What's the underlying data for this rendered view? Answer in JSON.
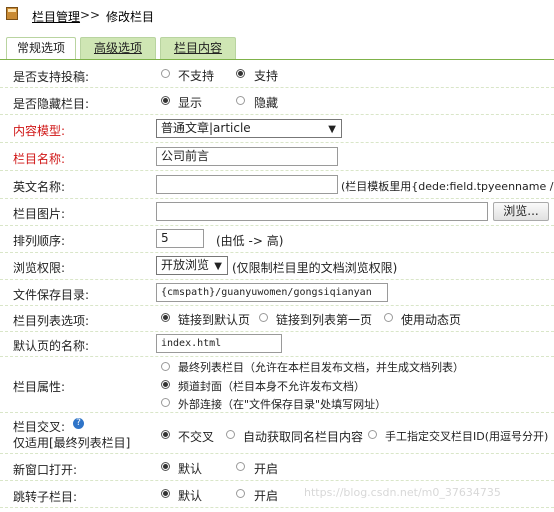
{
  "breadcrumb": {
    "section": "栏目管理",
    "separator": ">>",
    "current": "修改栏目"
  },
  "tabs": [
    {
      "label": "常规选项",
      "active": true
    },
    {
      "label": "高级选项",
      "active": false
    },
    {
      "label": "栏目内容",
      "active": false
    }
  ],
  "form": {
    "allow_submit": {
      "label": "是否支持投稿:",
      "options": [
        "不支持",
        "支持"
      ],
      "selected": "支持"
    },
    "hidden": {
      "label": "是否隐藏栏目:",
      "options": [
        "显示",
        "隐藏"
      ],
      "selected": "显示"
    },
    "content_model": {
      "label": "内容模型:",
      "value": "普通文章|article"
    },
    "type_name": {
      "label": "栏目名称:",
      "value": "公司前言"
    },
    "english_name": {
      "label": "英文名称:",
      "value": "",
      "hint": "(栏目模板里用{dede:field.tpyeenname /}i"
    },
    "type_image": {
      "label": "栏目图片:",
      "value": "",
      "button": "浏览..."
    },
    "sort_rank": {
      "label": "排列顺序:",
      "value": "5",
      "hint": "(由低 -> 高)"
    },
    "browse_perm": {
      "label": "浏览权限:",
      "value": "开放浏览",
      "hint": "(仅限制栏目里的文档浏览权限)"
    },
    "save_dir": {
      "label": "文件保存目录:",
      "value": "{cmspath}/guanyuwomen/gongsiqianyan"
    },
    "list_option": {
      "label": "栏目列表选项:",
      "options": [
        "链接到默认页",
        "链接到列表第一页",
        "使用动态页"
      ],
      "selected": "链接到默认页"
    },
    "default_page": {
      "label": "默认页的名称:",
      "value": "index.html"
    },
    "attribute": {
      "label": "栏目属性:",
      "options": [
        "最终列表栏目（允许在本栏目发布文档，并生成文档列表）",
        "频道封面（栏目本身不允许发布文档）",
        "外部连接（在\"文件保存目录\"处填写网址）"
      ],
      "selected": "频道封面（栏目本身不允许发布文档）"
    },
    "cross": {
      "label": "栏目交叉:",
      "sublabel": "仅适用[最终列表栏目]",
      "options": [
        "不交叉",
        "自动获取同名栏目内容",
        "手工指定交叉栏目ID(用逗号分开)"
      ],
      "selected": "不交叉"
    },
    "new_window": {
      "label": "新窗口打开:",
      "options": [
        "默认",
        "开启"
      ],
      "selected": "默认"
    },
    "jump": {
      "label": "跳转子栏目:",
      "options": [
        "默认",
        "开启"
      ],
      "selected": "默认"
    }
  },
  "watermark": "https://blog.csdn.net/m0_37634735"
}
